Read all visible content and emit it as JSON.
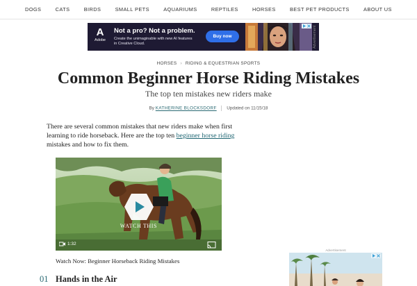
{
  "nav": {
    "items": [
      "DOGS",
      "CATS",
      "BIRDS",
      "SMALL PETS",
      "AQUARIUMS",
      "REPTILES",
      "HORSES",
      "BEST PET PRODUCTS",
      "ABOUT US"
    ]
  },
  "ad_banner": {
    "logo_word": "Adobe",
    "headline": "Not a pro? Not a problem.",
    "subtext": "Create the unimaginable with new AI features in Creative Cloud.",
    "button_label": "Buy now",
    "side_label": "Advertisement",
    "colors": {
      "background": "#1e1a33",
      "button": "#2f6fe8"
    }
  },
  "breadcrumb": {
    "items": [
      "HORSES",
      "RIDING & EQUESTRIAN SPORTS"
    ]
  },
  "article": {
    "title": "Common Beginner Horse Riding Mistakes",
    "subtitle": "The top ten mistakes new riders make",
    "byline_prefix": "By",
    "author": "KATHERINE BLOCKSDORF",
    "updated": "Updated on 11/15/18",
    "intro_before_link": "There are several common mistakes that new riders make when first learning to ride horseback. Here are the top ten ",
    "intro_link": "beginner horse riding",
    "intro_after_link": " mistakes and how to fix them.",
    "accent_color": "#2a6a73"
  },
  "video": {
    "overlay_label": "WATCH THIS",
    "duration": "1:32",
    "caption": "Watch Now: Beginner Horseback Riding Mistakes"
  },
  "steps": [
    {
      "number": "01",
      "title": "Hands in the Air"
    }
  ],
  "side_ad": {
    "label": "Advertisement"
  }
}
